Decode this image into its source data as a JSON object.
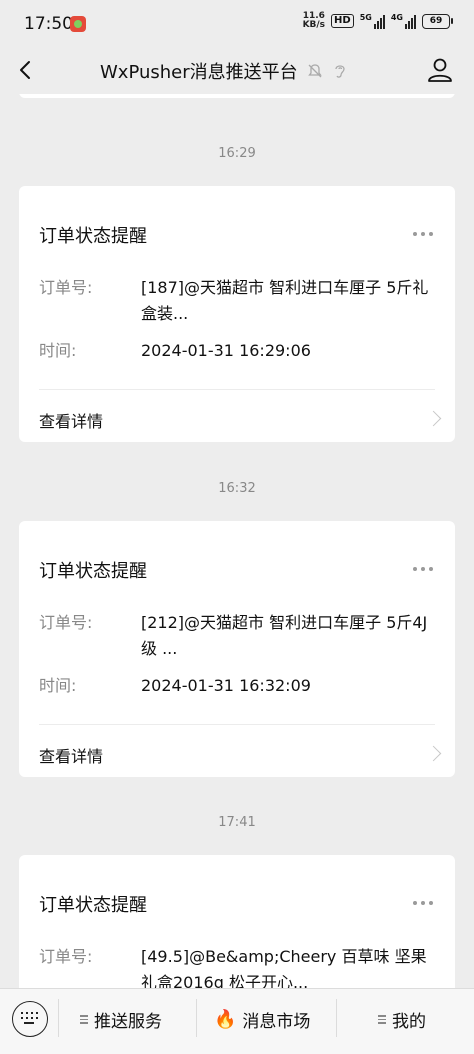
{
  "status_bar": {
    "time": "17:50",
    "speed_value": "11.6",
    "speed_unit": "KB/s",
    "hd": "HD",
    "net1": "5G",
    "net2": "4G",
    "battery": "69"
  },
  "nav": {
    "title": "WxPusher消息推送平台"
  },
  "messages": [
    {
      "time": "16:29",
      "title": "订单状态提醒",
      "order_label": "订单号:",
      "order_value": "[187]@天猫超市 智利进口车厘子 5斤礼盒装...",
      "time_label": "时间:",
      "time_value": "2024-01-31 16:29:06",
      "detail": "查看详情"
    },
    {
      "time": "16:32",
      "title": "订单状态提醒",
      "order_label": "订单号:",
      "order_value": "[212]@天猫超市 智利进口车厘子 5斤4J级 ...",
      "time_label": "时间:",
      "time_value": "2024-01-31 16:32:09",
      "detail": "查看详情"
    },
    {
      "time": "17:41",
      "title": "订单状态提醒",
      "order_label": "订单号:",
      "order_value": "[49.5]@Be&amp;Cheery 百草味 坚果礼盒2016g 松子开心...",
      "time_label": "",
      "time_value": "",
      "detail": ""
    }
  ],
  "bottom_menu": {
    "item1": "推送服务",
    "item2": "消息市场",
    "item2_icon": "🔥",
    "item3": "我的"
  }
}
